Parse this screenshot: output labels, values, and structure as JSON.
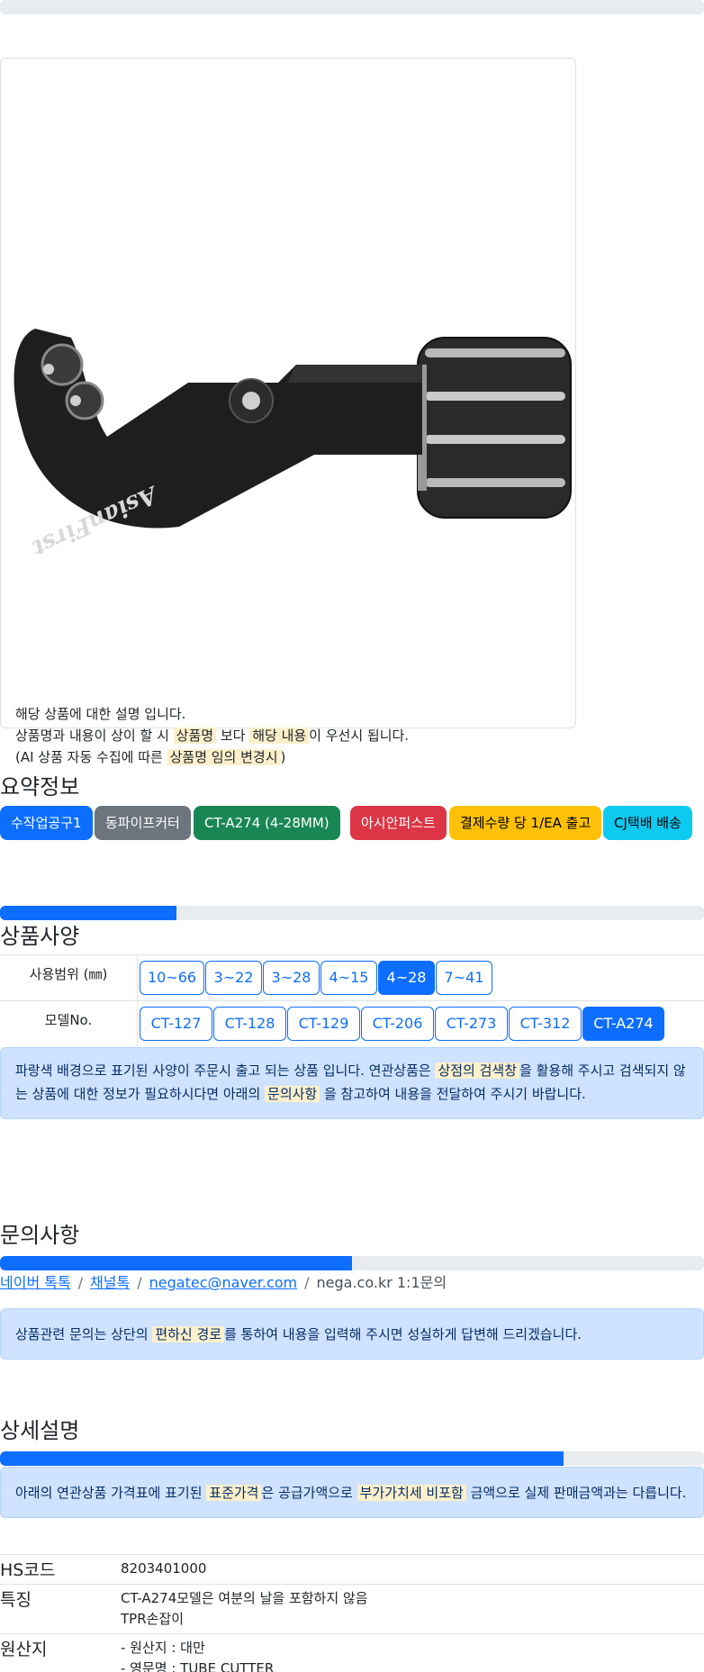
{
  "top_progress": {
    "fill": 0
  },
  "product_card": {
    "description": {
      "line1": "해당 상품에 대한 설명 입니다.",
      "line2_prefix": "상품명과 내용이 상이 할 시 ",
      "line2_mark1": "상품명",
      "line2_mid": " 보다 ",
      "line2_mark2": "해당 내용",
      "line2_suffix": "이 우선시 됩니다.",
      "line3_prefix": "(AI 상품 자동 수집에 따른 ",
      "line3_mark": "상품명 임의 변경시",
      "line3_suffix": ")"
    },
    "image_alt": "AsianFirst tube cutter",
    "brand_text": "AsianFirst"
  },
  "summary": {
    "title": "요약정보",
    "badges": [
      {
        "label": "수작업공구1",
        "color": "#0d6efd",
        "text_color": "#ffffff"
      },
      {
        "label": "동파이프커터",
        "color": "#6c757d",
        "text_color": "#ffffff"
      },
      {
        "label": "CT-A274 (4-28MM)",
        "color": "#198754",
        "text_color": "#ffffff"
      },
      {
        "label": "아시안퍼스트",
        "color": "#dc3545",
        "text_color": "#ffffff"
      },
      {
        "label": "결제수량 당 1/EA 출고",
        "color": "#ffc107",
        "text_color": "#000000"
      },
      {
        "label": "CJ택배 배송",
        "color": "#0dcaf0",
        "text_color": "#000000"
      }
    ]
  },
  "specs": {
    "progress": 0.25,
    "title": "상품사양",
    "rows": [
      {
        "label": "사용범위 (㎜)",
        "options": [
          "10~66",
          "3~22",
          "3~28",
          "4~15",
          "4~28",
          "7~41"
        ],
        "selected": "4~28"
      },
      {
        "label": "모델No.",
        "options": [
          "CT-127",
          "CT-128",
          "CT-129",
          "CT-206",
          "CT-273",
          "CT-312",
          "CT-A274"
        ],
        "selected": "CT-A274"
      }
    ],
    "notice": {
      "prefix": "파랑색 배경으로 표기된 사양이 주문시 출고 되는 상품 입니다. 연관상품은 ",
      "mark1": "상점의 검색창",
      "mid": "을 활용해 주시고 검색되지 않",
      "line2_prefix": "는 상품에 대한 정보가 필요하시다면 아래의 ",
      "mark2": "문의사항",
      "suffix": " 을 참고하여 내용을 전달하여 주시기 바랍니다."
    }
  },
  "inquiry": {
    "title": "문의사항",
    "progress": 0.5,
    "links": [
      "네이버 톡톡",
      "채널톡",
      "negatec@naver.com"
    ],
    "last": "nega.co.kr 1:1문의",
    "notice": {
      "prefix": "상품관련 문의는 상단의 ",
      "mark": "편하신 경로",
      "suffix": "를 통하여 내용을 입력해 주시면 성실하게 답변해 드리겠습니다."
    }
  },
  "detail": {
    "title": "상세설명",
    "progress": 0.8,
    "notice": {
      "prefix": "아래의 연관상품 가격표에 표기된 ",
      "mark1": "표준가격",
      "mid": "은 공급가액으로 ",
      "mark2": "부가가치세 비포함",
      "suffix": " 금액으로 실제 판매금액과는 다릅니다."
    },
    "rows": [
      {
        "key": "HS코드",
        "values": [
          "8203401000"
        ]
      },
      {
        "key": "특징",
        "values": [
          "CT-A274모델은 여분의 날을 포함하지 않음",
          "TPR손잡이"
        ]
      },
      {
        "key": "원산지",
        "values": [
          "- 원산지 : 대만",
          "- 영문명 : TUBE CUTTER"
        ]
      }
    ]
  }
}
